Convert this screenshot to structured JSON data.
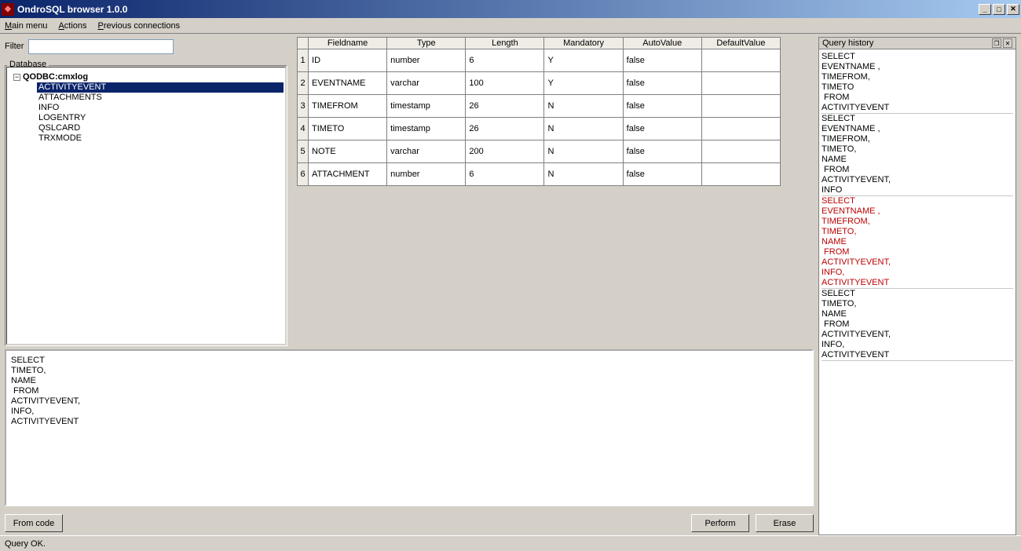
{
  "window": {
    "title": "OndroSQL browser 1.0.0"
  },
  "menu": {
    "main": "Main menu",
    "actions": "Actions",
    "previous": "Previous connections"
  },
  "filter": {
    "label": "Filter",
    "value": ""
  },
  "dbpanel": {
    "title": "Database",
    "root": "QODBC:cmxlog",
    "items": [
      "ACTIVITYEVENT",
      "ATTACHMENTS",
      "INFO",
      "LOGENTRY",
      "QSLCARD",
      "TRXMODE"
    ],
    "selected": "ACTIVITYEVENT"
  },
  "grid": {
    "headers": [
      "Fieldname",
      "Type",
      "Length",
      "Mandatory",
      "AutoValue",
      "DefaultValue"
    ],
    "rows": [
      {
        "n": "1",
        "Fieldname": "ID",
        "Type": "number",
        "Length": "6",
        "Mandatory": "Y",
        "AutoValue": "false",
        "DefaultValue": ""
      },
      {
        "n": "2",
        "Fieldname": "EVENTNAME",
        "Type": "varchar",
        "Length": "100",
        "Mandatory": "Y",
        "AutoValue": "false",
        "DefaultValue": ""
      },
      {
        "n": "3",
        "Fieldname": "TIMEFROM",
        "Type": "timestamp",
        "Length": "26",
        "Mandatory": "N",
        "AutoValue": "false",
        "DefaultValue": ""
      },
      {
        "n": "4",
        "Fieldname": "TIMETO",
        "Type": "timestamp",
        "Length": "26",
        "Mandatory": "N",
        "AutoValue": "false",
        "DefaultValue": ""
      },
      {
        "n": "5",
        "Fieldname": "NOTE",
        "Type": "varchar",
        "Length": "200",
        "Mandatory": "N",
        "AutoValue": "false",
        "DefaultValue": ""
      },
      {
        "n": "6",
        "Fieldname": "ATTACHMENT",
        "Type": "number",
        "Length": "6",
        "Mandatory": "N",
        "AutoValue": "false",
        "DefaultValue": ""
      }
    ]
  },
  "editor": {
    "text": "SELECT\nTIMETO,\nNAME\n FROM\nACTIVITYEVENT,\nINFO,\nACTIVITYEVENT"
  },
  "buttons": {
    "fromcode": "From code",
    "perform": "Perform",
    "erase": "Erase"
  },
  "history": {
    "title": "Query history",
    "entries": [
      {
        "text": "SELECT\nEVENTNAME ,\nTIMEFROM,\nTIMETO\n FROM\nACTIVITYEVENT",
        "red": false
      },
      {
        "text": "SELECT\nEVENTNAME ,\nTIMEFROM,\nTIMETO,\nNAME\n FROM\nACTIVITYEVENT,\nINFO",
        "red": false
      },
      {
        "text": "SELECT\nEVENTNAME ,\nTIMEFROM,\nTIMETO,\nNAME\n FROM\nACTIVITYEVENT,\nINFO,\nACTIVITYEVENT",
        "red": true
      },
      {
        "text": "SELECT\nTIMETO,\nNAME\n FROM\nACTIVITYEVENT,\nINFO,\nACTIVITYEVENT",
        "red": false
      }
    ]
  },
  "status": {
    "text": "Query OK."
  }
}
